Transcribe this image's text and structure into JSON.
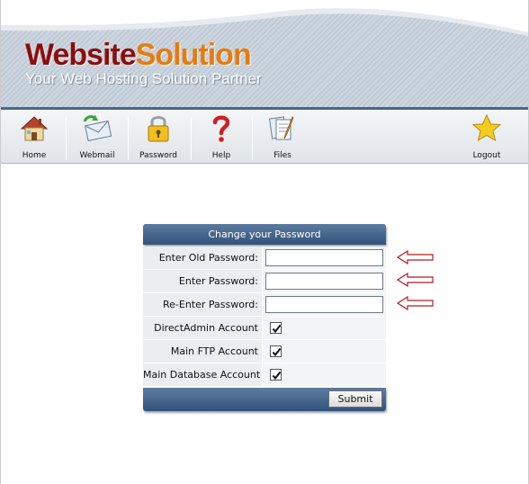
{
  "brand": {
    "name_part1": "Website",
    "name_part2": "Solution",
    "tagline": "Your Web Hosting Solution Partner"
  },
  "toolbar": {
    "items": [
      {
        "label": "Home",
        "icon": "house-icon"
      },
      {
        "label": "Webmail",
        "icon": "envelope-icon"
      },
      {
        "label": "Password",
        "icon": "padlock-icon"
      },
      {
        "label": "Help",
        "icon": "question-mark-icon"
      },
      {
        "label": "Files",
        "icon": "files-icon"
      },
      {
        "label": "Logout",
        "icon": "star-icon"
      }
    ]
  },
  "form": {
    "title": "Change your Password",
    "fields": [
      {
        "label": "Enter Old Password:",
        "value": ""
      },
      {
        "label": "Enter Password:",
        "value": ""
      },
      {
        "label": "Re-Enter Password:",
        "value": ""
      }
    ],
    "checkboxes": [
      {
        "label": "DirectAdmin Account",
        "checked": true
      },
      {
        "label": "Main FTP Account",
        "checked": true
      },
      {
        "label": "Main Database Account",
        "checked": true
      }
    ],
    "submit_label": "Submit"
  },
  "colors": {
    "brand_dark_red": "#8b0e0e",
    "brand_orange": "#e87a10",
    "panel_blue": "#3f5f86",
    "arrow_red": "#b01e1e"
  }
}
